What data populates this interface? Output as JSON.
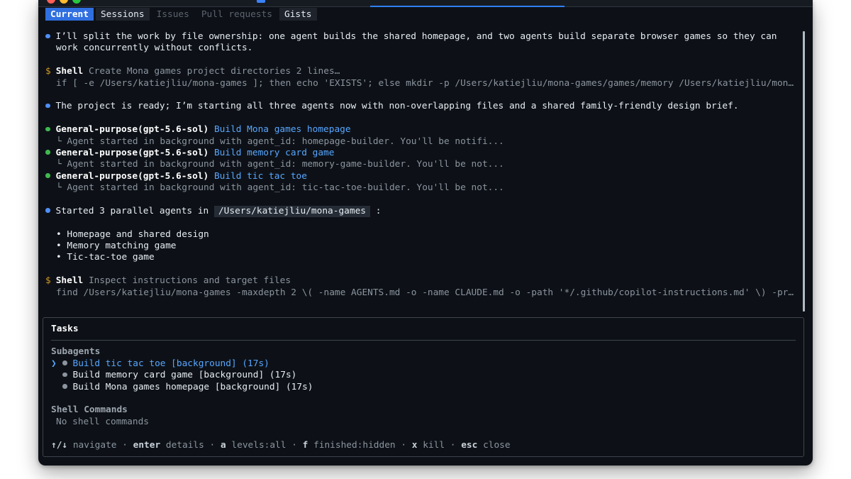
{
  "tabs": [
    {
      "label": "Current",
      "state": "active"
    },
    {
      "label": "Sessions",
      "state": "enabled"
    },
    {
      "label": "Issues",
      "state": "disabled"
    },
    {
      "label": "Pull requests",
      "state": "disabled"
    },
    {
      "label": "Gists",
      "state": "enabled"
    }
  ],
  "transcript": {
    "msg1_line1": "I’ll split the work by file ownership: one agent builds the shared homepage, and two agents build separate browser games so they can",
    "msg1_line2": "work concurrently without conflicts.",
    "shell1": {
      "label": "Shell",
      "description": "Create Mona games project directories 2 lines…",
      "command": "if [ -e /Users/katiejliu/mona-games ]; then echo 'EXISTS'; else mkdir -p /Users/katiejliu/mona-games/games/memory /Users/katiejliu/mon…"
    },
    "msg2": "The project is ready; I’m starting all three agents now with non-overlapping files and a shared family-friendly design brief.",
    "agents": [
      {
        "name": "General-purpose(gpt-5.6-sol)",
        "task": "Build Mona games homepage",
        "detail": "└ Agent started in background with agent_id: homepage-builder. You'll be notifi..."
      },
      {
        "name": "General-purpose(gpt-5.6-sol)",
        "task": "Build memory card game",
        "detail": "└ Agent started in background with agent_id: memory-game-builder. You'll be not..."
      },
      {
        "name": "General-purpose(gpt-5.6-sol)",
        "task": "Build tic tac toe",
        "detail": "└ Agent started in background with agent_id: tic-tac-toe-builder. You'll be not..."
      }
    ],
    "msg3_prefix": "Started 3 parallel agents in",
    "msg3_path": "/Users/katiejliu/mona-games",
    "msg3_suffix": ":",
    "list_items": [
      "• Homepage and shared design",
      "• Memory matching game",
      "• Tic-tac-toe game"
    ],
    "shell2": {
      "label": "Shell",
      "description": "Inspect instructions and target files",
      "command": "find /Users/katiejliu/mona-games -maxdepth 2 \\( -name AGENTS.md -o -name CLAUDE.md -o -path '*/.github/copilot-instructions.md' \\) -pr…"
    },
    "prompt_symbol": "$"
  },
  "tasks_panel": {
    "title": "Tasks",
    "subagents_heading": "Subagents",
    "selector": "❯",
    "subagents": [
      {
        "label": "Build tic tac toe [background] (17s)",
        "selected": true
      },
      {
        "label": "Build memory card game [background] (17s)",
        "selected": false
      },
      {
        "label": "Build Mona games homepage [background] (17s)",
        "selected": false
      }
    ],
    "shell_heading": "Shell Commands",
    "shell_empty": "No shell commands",
    "hints": {
      "navigate_key": "↑/↓",
      "navigate": "navigate",
      "enter_key": "enter",
      "enter": "details",
      "a_key": "a",
      "a": "levels:all",
      "f_key": "f",
      "f": "finished:hidden",
      "x_key": "x",
      "x": "kill",
      "esc_key": "esc",
      "esc": "close",
      "sep": "·"
    }
  },
  "colors": {
    "background": "#0d1117",
    "accent": "#2f6fe0",
    "link": "#58a6ff",
    "success": "#3fb950",
    "prompt": "#d29922"
  }
}
